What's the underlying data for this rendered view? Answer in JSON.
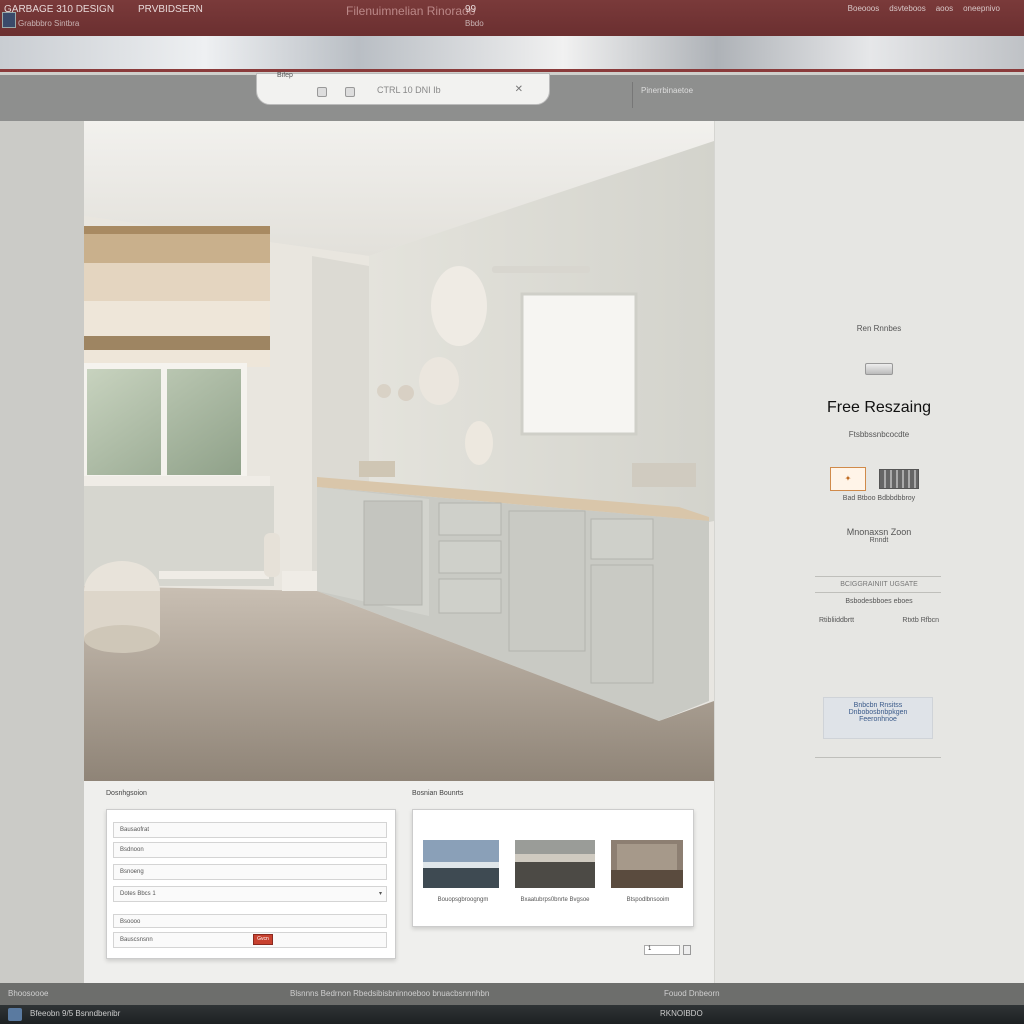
{
  "window": {
    "title": "GARBAGE 310 DESIGN",
    "menu_label": "PRVBIDSERN",
    "center_text": "Filenuimnelian Rinoraoo",
    "sub_left": "Grabbbro Sintbra",
    "right_code": "99",
    "right_sub": "Bbdo",
    "controls": [
      "Boeooos",
      "dsvteboos",
      "aoos",
      "oneepnivo"
    ]
  },
  "address": {
    "tab_label": "Bifep",
    "url_text": "CTRL 10 DNI Ib",
    "right_text": "Pinerrbinaetoe"
  },
  "lower": {
    "form_section_label": "Dosnhgsoion",
    "gallery_section_label": "Bosnian Bounrts",
    "form_rows": [
      "Bausaofrat",
      "Bsdnoon",
      "Bsnoeng",
      "Dotes Bbcs 1",
      "Bsoooo",
      "Bauscsnsnn"
    ],
    "form_button": "Gvcn",
    "gallery_captions": [
      "Bouopsgbroogngm",
      "Bxaatubrps0bnrte Bvgsoe",
      "Btspodlbnsooim"
    ],
    "pager_value": "1"
  },
  "promo": {
    "eyebrow": "Ren Rnnbes",
    "title": "Free Reszaing",
    "subtitle": "Ftsbbssnbcocdte",
    "logo_caption": "Bad Btboo Bdbbdbbroy",
    "mid_title": "Mnonaxsn Zoon",
    "mid_sub": "Rnndt",
    "list_heading": "BCIGGRAINIIT UGSATE",
    "list_line": "Bsbodesbboes eboes",
    "list_left": "Rtibliiddbrtt",
    "list_right": "Rtxtb Rfbcn",
    "box_line1": "Bnbcbn Rnsitss",
    "box_line2": "Dnbobosbnbpkgen",
    "box_line3": "Feeronhnoe"
  },
  "status": {
    "left": "Bhoosoooe",
    "center": "Blsnnns Bedrnon Rbedsibisbninnoeboo bnuacbsnnnhbn",
    "right": "Fouod Dnbeorn"
  },
  "taskbar": {
    "item1": "Bfeeobn 9/5 Bsnndbenibr",
    "item2": "RKNOIBDO"
  },
  "colors": {
    "titlebar": "#6b2f30",
    "accent_red": "#c8412f",
    "panel": "#e6e6e3"
  }
}
